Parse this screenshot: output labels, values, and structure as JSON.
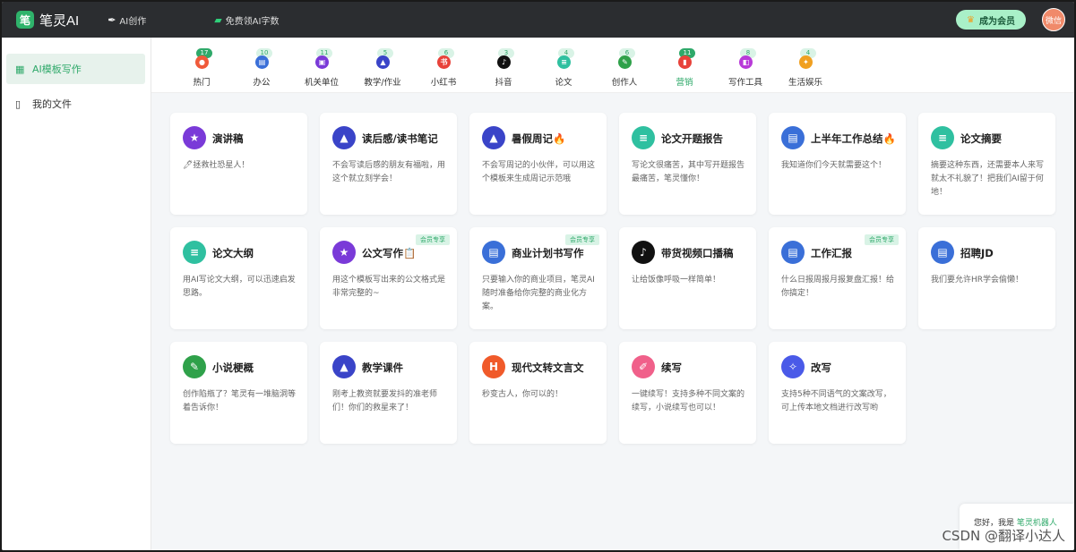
{
  "app": {
    "logo_text": "笔灵AI",
    "logo_mark": "笔"
  },
  "topbar": {
    "ai_create": "AI创作",
    "free_words": "免费领AI字数",
    "vip_button": "成为会员",
    "avatar_text": "微信"
  },
  "sidebar": {
    "items": [
      {
        "label": "AI模板写作",
        "active": true
      },
      {
        "label": "我的文件",
        "active": false
      }
    ]
  },
  "tabs": [
    {
      "label": "热门",
      "badge": "17",
      "icon": "fire-icon",
      "color": "#f05a3a",
      "glyph": "●",
      "active": false,
      "strong": true
    },
    {
      "label": "办公",
      "badge": "10",
      "icon": "briefcase-icon",
      "color": "#3a6fd8",
      "glyph": "▤",
      "active": false,
      "strong": false
    },
    {
      "label": "机关单位",
      "badge": "11",
      "icon": "building-icon",
      "color": "#7a3ad8",
      "glyph": "▣",
      "active": false,
      "strong": false
    },
    {
      "label": "教学/作业",
      "badge": "5",
      "icon": "graduation-cap-icon",
      "color": "#3a44c8",
      "glyph": "▲",
      "active": false,
      "strong": false
    },
    {
      "label": "小红书",
      "badge": "6",
      "icon": "redbook-icon",
      "color": "#e8423a",
      "glyph": "书",
      "active": false,
      "strong": false
    },
    {
      "label": "抖音",
      "badge": "3",
      "icon": "tiktok-icon",
      "color": "#111111",
      "glyph": "♪",
      "active": false,
      "strong": false
    },
    {
      "label": "论文",
      "badge": "4",
      "icon": "paper-icon",
      "color": "#2fc0a0",
      "glyph": "≡",
      "active": false,
      "strong": false
    },
    {
      "label": "创作人",
      "badge": "6",
      "icon": "pen-icon",
      "color": "#2fa14a",
      "glyph": "✎",
      "active": false,
      "strong": false
    },
    {
      "label": "营销",
      "badge": "11",
      "icon": "marketing-icon",
      "color": "#e8423a",
      "glyph": "▮",
      "active": true,
      "strong": true
    },
    {
      "label": "写作工具",
      "badge": "8",
      "icon": "tools-icon",
      "color": "#b83ad8",
      "glyph": "◧",
      "active": false,
      "strong": false
    },
    {
      "label": "生活娱乐",
      "badge": "4",
      "icon": "entertainment-icon",
      "color": "#f0a020",
      "glyph": "✦",
      "active": false,
      "strong": false
    }
  ],
  "cards": [
    {
      "title": "演讲稿",
      "desc": "🖊拯救社恐星人！",
      "icon": "star-icon",
      "color": "#7a3ad8",
      "glyph": "★",
      "tag": ""
    },
    {
      "title": "读后感/读书笔记",
      "desc": "不会写读后感的朋友有福啦，用这个就立刻学会！",
      "icon": "graduation-cap-icon",
      "color": "#3a44c8",
      "glyph": "▲",
      "tag": ""
    },
    {
      "title": "暑假周记🔥",
      "desc": "不会写周记的小伙伴，可以用这个模板来生成周记示范哦",
      "icon": "graduation-cap-icon",
      "color": "#3a44c8",
      "glyph": "▲",
      "tag": ""
    },
    {
      "title": "论文开题报告",
      "desc": "写论文很痛苦，其中写开题报告最痛苦，笔灵懂你！",
      "icon": "paper-icon",
      "color": "#2fc0a0",
      "glyph": "≡",
      "tag": ""
    },
    {
      "title": "上半年工作总结🔥",
      "desc": "我知道你们今天就需要这个！",
      "icon": "briefcase-icon",
      "color": "#3a6fd8",
      "glyph": "▤",
      "tag": ""
    },
    {
      "title": "论文摘要",
      "desc": "摘要这种东西，还需要本人来写就太不礼貌了！把我们AI留于何地！",
      "icon": "paper-icon",
      "color": "#2fc0a0",
      "glyph": "≡",
      "tag": ""
    },
    {
      "title": "论文大纲",
      "desc": "用AI写论文大纲，可以迅速启发思路。",
      "icon": "paper-icon",
      "color": "#2fc0a0",
      "glyph": "≡",
      "tag": ""
    },
    {
      "title": "公文写作📋",
      "desc": "用这个模板写出来的公文格式是非常完整的~",
      "icon": "star-icon",
      "color": "#7a3ad8",
      "glyph": "★",
      "tag": "会员专享"
    },
    {
      "title": "商业计划书写作",
      "desc": "只要输入你的商业项目，笔灵AI随时准备给你完整的商业化方案。",
      "icon": "briefcase-icon",
      "color": "#3a6fd8",
      "glyph": "▤",
      "tag": "会员专享"
    },
    {
      "title": "带货视频口播稿",
      "desc": "让给饭像呼吸一样简单！",
      "icon": "tiktok-icon",
      "color": "#111111",
      "glyph": "♪",
      "tag": ""
    },
    {
      "title": "工作汇报",
      "desc": "什么日报周报月报复盘汇报！给你搞定！",
      "icon": "briefcase-icon",
      "color": "#3a6fd8",
      "glyph": "▤",
      "tag": "会员专享"
    },
    {
      "title": "招聘JD",
      "desc": "我们要允许HR学会偷懒！",
      "icon": "briefcase-icon",
      "color": "#3a6fd8",
      "glyph": "▤",
      "tag": ""
    },
    {
      "title": "小说梗概",
      "desc": "创作陷瓶了？笔灵有一堆脑洞等着告诉你！",
      "icon": "pen-icon",
      "color": "#2fa14a",
      "glyph": "✎",
      "tag": ""
    },
    {
      "title": "教学课件",
      "desc": "刚考上教资就要发抖的准老师们！你们的救星来了！",
      "icon": "graduation-cap-icon",
      "color": "#3a44c8",
      "glyph": "▲",
      "tag": ""
    },
    {
      "title": "现代文转文言文",
      "desc": "秒变古人，你可以的！",
      "icon": "html-icon",
      "color": "#f05a2a",
      "glyph": "H",
      "tag": ""
    },
    {
      "title": "续写",
      "desc": "一键续写！支持多种不同文案的续写，小说续写也可以！",
      "icon": "continue-write-icon",
      "color": "#f0608a",
      "glyph": "✐",
      "tag": ""
    },
    {
      "title": "改写",
      "desc": "支持5种不同语气的文案改写，可上传本地文档进行改写哟",
      "icon": "rewrite-icon",
      "color": "#4a5ae8",
      "glyph": "✧",
      "tag": ""
    }
  ],
  "chat": {
    "prefix": "您好，我是 ",
    "name": "笔灵机器人"
  },
  "watermark": "CSDN @翻译小达人"
}
